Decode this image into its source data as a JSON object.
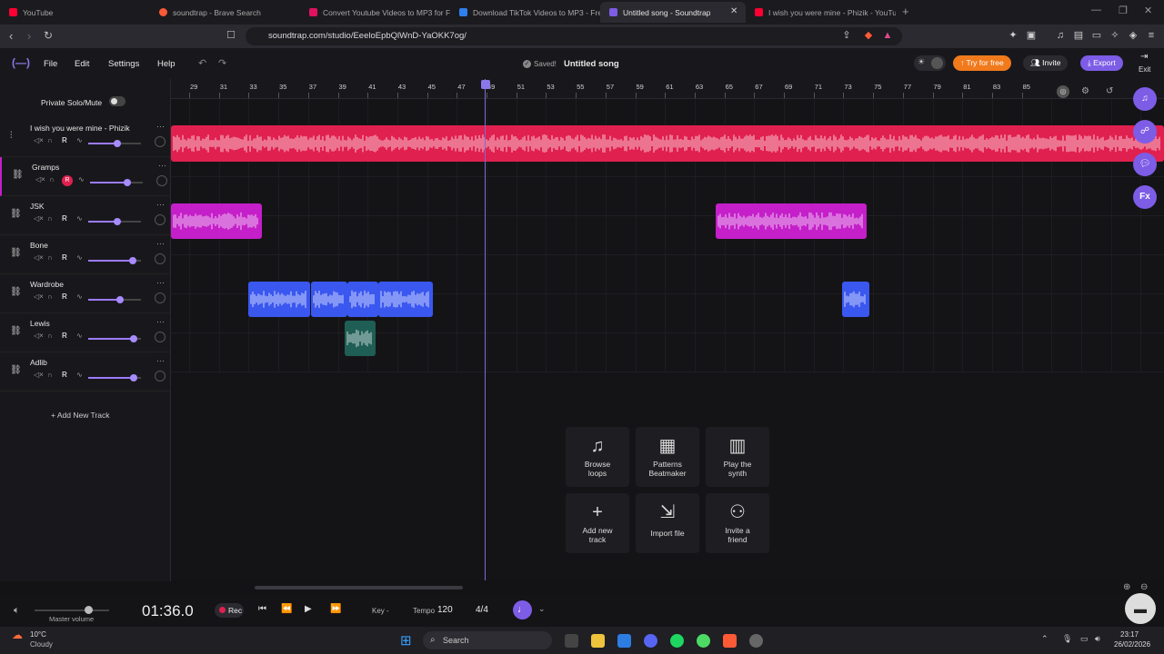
{
  "browser": {
    "tabs": [
      {
        "label": "YouTube",
        "color": "#ff0033"
      },
      {
        "label": "soundtrap - Brave Search",
        "color": "#ff5a36"
      },
      {
        "label": "Convert Youtube Videos to MP3 for F",
        "color": "#e0115f"
      },
      {
        "label": "Download TikTok Videos to MP3 - Fre",
        "color": "#2f80ed"
      },
      {
        "label": "Untitled song - Soundtrap",
        "color": "#7d5ce6"
      },
      {
        "label": "I wish you were mine - Phizik - YouTu",
        "color": "#ff0033"
      }
    ],
    "url": "soundtrap.com/studio/EeeloEpbQlWnD-YaOKK7og/"
  },
  "app": {
    "menu": [
      "File",
      "Edit",
      "Settings",
      "Help"
    ],
    "saved": "Saved!",
    "song_title": "Untitled song",
    "try_label": "Try for free",
    "invite_label": "Invite",
    "export_label": "Export",
    "exit_label": "Exit",
    "private_solo": "Private Solo/Mute",
    "add_track": "Add New Track",
    "accent": "#7d5ce6"
  },
  "ruler_ticks": [
    "29",
    "31",
    "33",
    "35",
    "37",
    "39",
    "41",
    "43",
    "45",
    "47",
    "49",
    "51",
    "53",
    "55",
    "57",
    "59",
    "61",
    "63",
    "65",
    "67",
    "69",
    "71",
    "73",
    "75",
    "77",
    "79",
    "81",
    "83",
    "85"
  ],
  "tracks": [
    {
      "name": "I wish you were mine - Phizik",
      "icon": "waveform-icon",
      "volume": 0.55
    },
    {
      "name": "Gramps",
      "icon": "link-icon",
      "volume": 0.7,
      "rec_armed": true
    },
    {
      "name": "JSK",
      "icon": "link-icon",
      "volume": 0.55
    },
    {
      "name": "Bone",
      "icon": "link-icon",
      "volume": 0.85
    },
    {
      "name": "Wardrobe",
      "icon": "link-icon",
      "volume": 0.6
    },
    {
      "name": "Lewis",
      "icon": "link-icon",
      "volume": 0.87
    },
    {
      "name": "Adlib",
      "icon": "link-icon",
      "volume": 0.87
    }
  ],
  "track_ctrl": {
    "rec": "R"
  },
  "quick_actions": [
    {
      "label1": "Browse",
      "label2": "loops"
    },
    {
      "label1": "Patterns",
      "label2": "Beatmaker"
    },
    {
      "label1": "Play the",
      "label2": "synth"
    },
    {
      "label1": "Add new",
      "label2": "track"
    },
    {
      "label1": "Import file",
      "label2": ""
    },
    {
      "label1": "Invite a",
      "label2": "friend"
    }
  ],
  "transport": {
    "master_volume": "Master volume",
    "time": "01:36.0",
    "rec": "Rec",
    "key_label": "Key",
    "key_value": "-",
    "tempo_label": "Tempo",
    "tempo_value": "120",
    "signature": "4/4"
  },
  "taskbar": {
    "temp": "10°C",
    "weather": "Cloudy",
    "search": "Search",
    "time": "23:17",
    "date": "26/02/2026"
  }
}
